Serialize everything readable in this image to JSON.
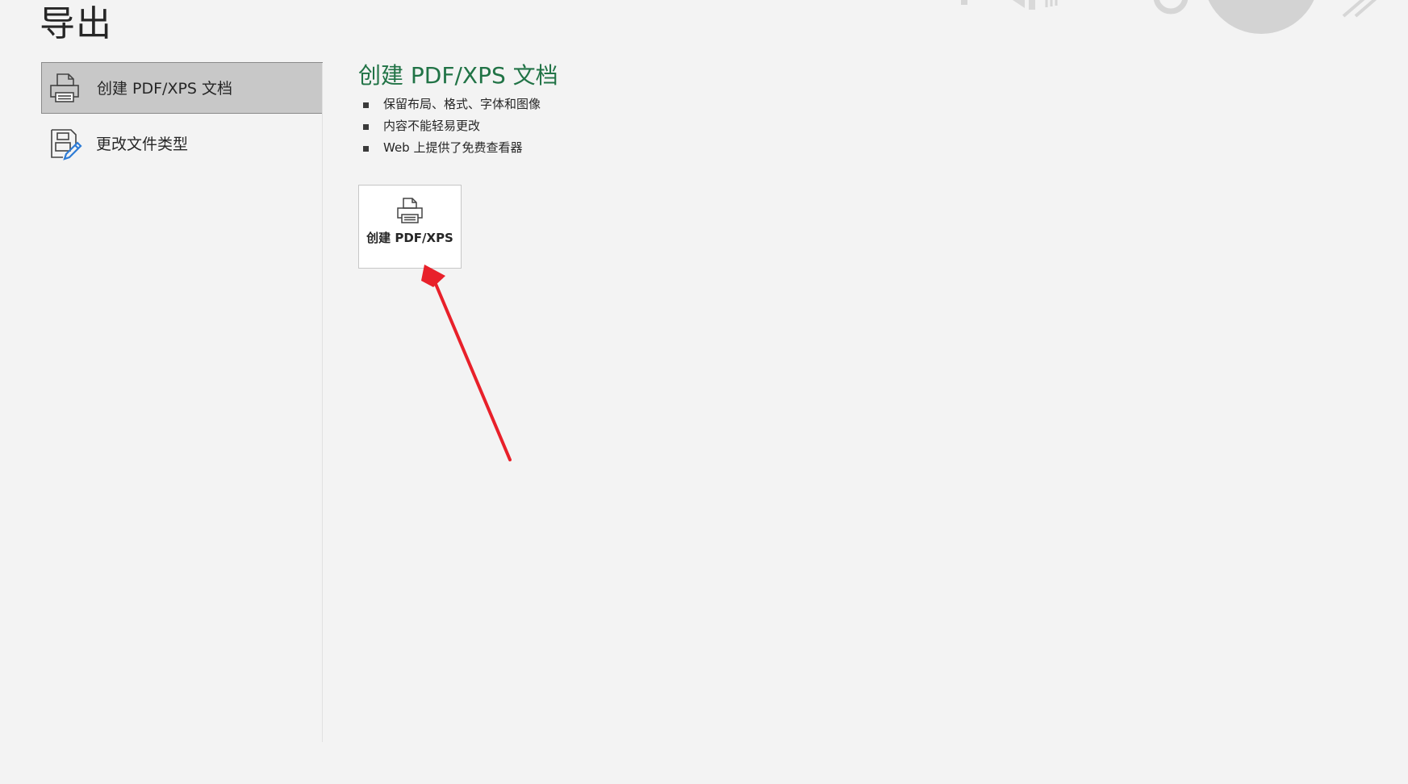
{
  "page": {
    "title": "导出"
  },
  "sidebar": {
    "items": [
      {
        "label": "创建 PDF/XPS 文档",
        "icon": "pdf-printer-icon",
        "selected": true
      },
      {
        "label": "更改文件类型",
        "icon": "change-file-type-icon",
        "selected": false
      }
    ]
  },
  "main": {
    "heading": "创建 PDF/XPS 文档",
    "bullets": [
      "保留布局、格式、字体和图像",
      "内容不能轻易更改",
      "Web 上提供了免费查看器"
    ],
    "action_button": {
      "label": "创建 PDF/XPS",
      "icon": "pdf-printer-icon"
    }
  },
  "colors": {
    "accent": "#217346",
    "background": "#f3f3f3",
    "selected_bg": "#c8c8c8",
    "annotation_arrow": "#e8202a"
  }
}
